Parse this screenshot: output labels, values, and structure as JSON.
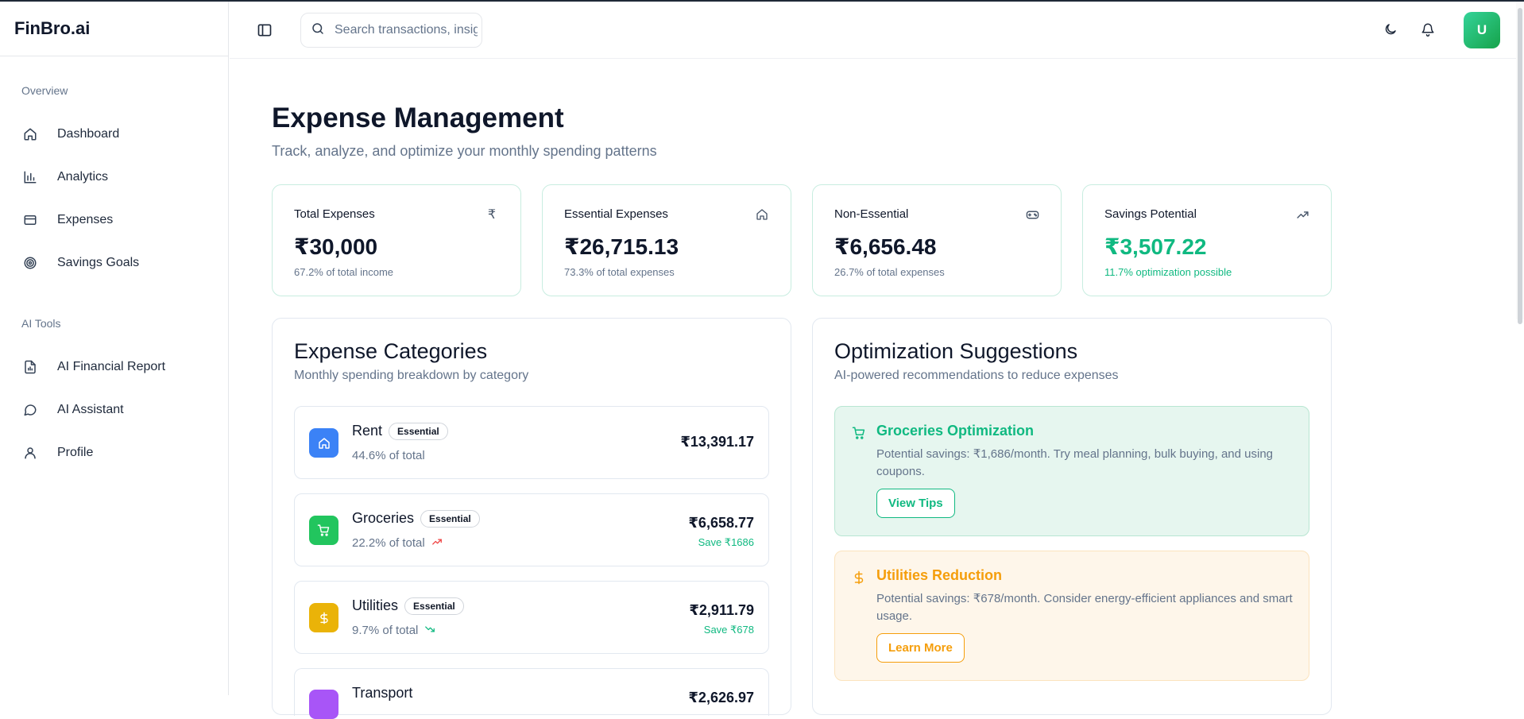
{
  "app": {
    "brand": "FinBro.ai"
  },
  "sidebar": {
    "groups": [
      {
        "label": "Overview",
        "items": [
          {
            "label": "Dashboard",
            "icon": "home-icon"
          },
          {
            "label": "Analytics",
            "icon": "bar-chart-icon"
          },
          {
            "label": "Expenses",
            "icon": "credit-card-icon"
          },
          {
            "label": "Savings Goals",
            "icon": "target-icon"
          }
        ]
      },
      {
        "label": "AI Tools",
        "items": [
          {
            "label": "AI Financial Report",
            "icon": "file-chart-icon"
          },
          {
            "label": "AI Assistant",
            "icon": "chat-bubble-icon"
          },
          {
            "label": "Profile",
            "icon": "user-icon"
          }
        ]
      }
    ]
  },
  "header": {
    "search_placeholder": "Search transactions, insights...",
    "avatar_initial": "U",
    "avatar_color": "#22c55e"
  },
  "page": {
    "title": "Expense Management",
    "subtitle": "Track, analyze, and optimize your monthly spending patterns"
  },
  "stats": [
    {
      "title": "Total Expenses",
      "value": "₹30,000",
      "sub": "67.2% of total income",
      "icon": "rupee-icon"
    },
    {
      "title": "Essential Expenses",
      "value": "₹26,715.13",
      "sub": "73.3% of total expenses",
      "icon": "home-icon"
    },
    {
      "title": "Non-Essential",
      "value": "₹6,656.48",
      "sub": "26.7% of total expenses",
      "icon": "gamepad-icon"
    },
    {
      "title": "Savings Potential",
      "value": "₹3,507.22",
      "sub": "11.7% optimization possible",
      "icon": "trending-up-icon",
      "accent": "#10b981"
    }
  ],
  "categories": {
    "title": "Expense Categories",
    "subtitle": "Monthly spending breakdown by category",
    "items": [
      {
        "name": "Rent",
        "badge": "Essential",
        "pct": "44.6% of total",
        "amount": "₹13,391.17",
        "save": "",
        "color": "#3b82f6",
        "icon": "home-icon",
        "trend": ""
      },
      {
        "name": "Groceries",
        "badge": "Essential",
        "pct": "22.2% of total",
        "amount": "₹6,658.77",
        "save": "Save ₹1686",
        "color": "#22c55e",
        "icon": "cart-icon",
        "trend": "up"
      },
      {
        "name": "Utilities",
        "badge": "Essential",
        "pct": "9.7% of total",
        "amount": "₹2,911.79",
        "save": "Save ₹678",
        "color": "#eab308",
        "icon": "dollar-icon",
        "trend": "down"
      },
      {
        "name": "Transport",
        "badge": "",
        "pct": "",
        "amount": "₹2,626.97",
        "save": "",
        "color": "#a855f7",
        "icon": "car-icon",
        "trend": ""
      }
    ]
  },
  "suggestions": {
    "title": "Optimization Suggestions",
    "subtitle": "AI-powered recommendations to reduce expenses",
    "items": [
      {
        "title": "Groceries Optimization",
        "text": "Potential savings: ₹1,686/month. Try meal planning, bulk buying, and using coupons.",
        "button": "View Tips",
        "icon": "cart-icon",
        "tone": "green"
      },
      {
        "title": "Utilities Reduction",
        "text": "Potential savings: ₹678/month. Consider energy-efficient appliances and smart usage.",
        "button": "Learn More",
        "icon": "dollar-icon",
        "tone": "amber"
      }
    ]
  }
}
